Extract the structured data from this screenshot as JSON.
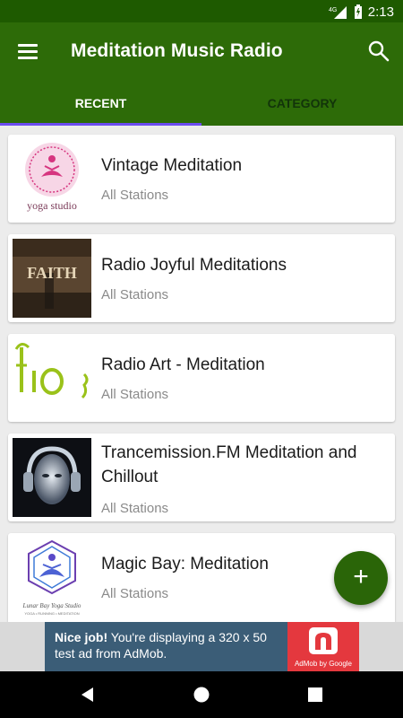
{
  "status_bar": {
    "network": "4G",
    "time": "2:13"
  },
  "app_bar": {
    "title": "Meditation Music Radio",
    "menu_icon": "hamburger-menu-icon",
    "search_icon": "search-icon"
  },
  "tabs": [
    {
      "label": "RECENT",
      "active": true
    },
    {
      "label": "CATEGORY",
      "active": false
    }
  ],
  "stations": [
    {
      "title": "Vintage Meditation",
      "subtitle": "All Stations",
      "thumb_caption": "yoga studio"
    },
    {
      "title": "Radio Joyful Meditations",
      "subtitle": "All Stations",
      "thumb_caption": "FAITH"
    },
    {
      "title": "Radio Art - Meditation",
      "subtitle": "All Stations"
    },
    {
      "title": "Trancemission.FM Meditation and Chillout",
      "subtitle": "All Stations"
    },
    {
      "title": "Magic Bay: Meditation",
      "subtitle": "All Stations",
      "thumb_caption": "Lunar Bay Yoga Studio",
      "thumb_caption_small": "YOGA • RUNNING • MEDITATION"
    }
  ],
  "fab": {
    "label": "+"
  },
  "ad": {
    "headline": "Nice job!",
    "text": " You're displaying a 320 x 50 test ad from AdMob.",
    "badge": "AdMob by Google"
  },
  "colors": {
    "status_bar": "#1e5a00",
    "app_bar": "#2d6b08",
    "tab_indicator": "#6c4cf0",
    "fab": "#2a6508",
    "ad_bg": "#3b5d77",
    "ad_badge": "#e4383e"
  }
}
